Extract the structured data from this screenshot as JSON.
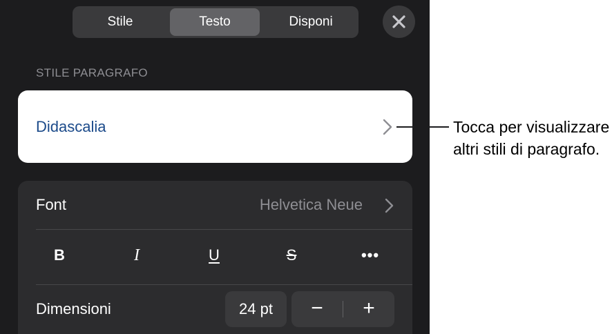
{
  "tabs": [
    {
      "label": "Stile",
      "selected": false
    },
    {
      "label": "Testo",
      "selected": true
    },
    {
      "label": "Disponi",
      "selected": false
    }
  ],
  "close_icon": "close-icon",
  "paragraph_style": {
    "section_header": "STILE PARAGRAFO",
    "current_style": "Didascalia"
  },
  "callout": {
    "text": "Tocca per visualizzare altri stili di paragrafo."
  },
  "font": {
    "label": "Font",
    "value": "Helvetica Neue"
  },
  "format_buttons": {
    "bold": "B",
    "italic": "I",
    "underline": "U",
    "strikethrough": "S",
    "more": "•••"
  },
  "size": {
    "label": "Dimensioni",
    "value": "24 pt",
    "decrease": "−",
    "increase": "+"
  },
  "colors": {
    "panel_background": "#1c1c1e",
    "group_background": "#2c2c2e",
    "style_text": "#1b4a8a",
    "secondary_text": "#8e8e93"
  }
}
